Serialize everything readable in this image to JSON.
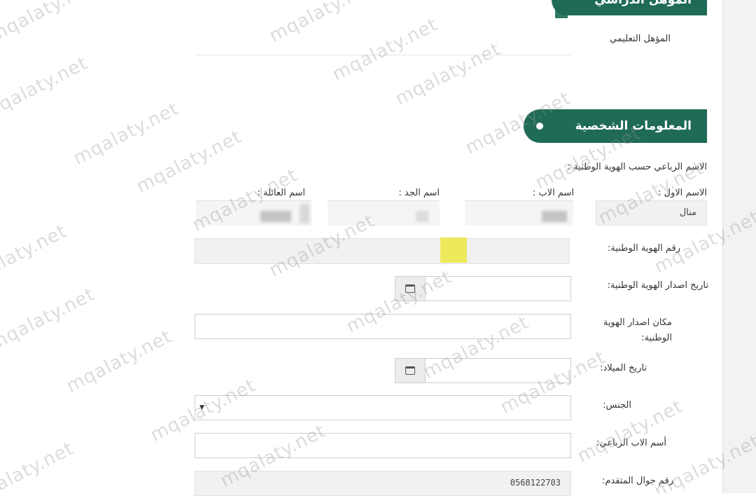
{
  "sections": {
    "education_title": "المؤهل الدراسي",
    "personal_title": "المعلومات الشخصية"
  },
  "education": {
    "qualification_label": "المؤهل التعليمي"
  },
  "personal": {
    "full_name_caption": "الاسم الرباعي حسب الهوية الوطنية :",
    "name_labels": {
      "first": "الاسم الاول :",
      "father": "اسم الاب :",
      "grandfather": "اسم الجد :",
      "family": "اسم العائلة :"
    },
    "first_name_value": "منال",
    "national_id_label": "رقم الهوية الوطنية:",
    "id_issue_date_label": "تاريخ اصدار الهوية الوطنية:",
    "id_issue_place_label": "مكان اصدار الهوية الوطنية:",
    "birth_date_label": "تاريخ الميلاد:",
    "gender_label": "الجنس:",
    "father_full_name_label": "أسم الاب الرباعي:",
    "mobile_label": "رقم جوال المتقدم:",
    "mobile_value": "0568122703"
  },
  "watermark_text": "mqalaty.net",
  "icons": {
    "calendar": "calendar-icon",
    "dropdown": "dropdown-caret-icon",
    "bullet": "bullet-dot-icon"
  },
  "colors": {
    "section_header_bg": "#1f6b57",
    "highlight": "#eee85c",
    "readonly_field_bg": "#f1f1f1"
  }
}
